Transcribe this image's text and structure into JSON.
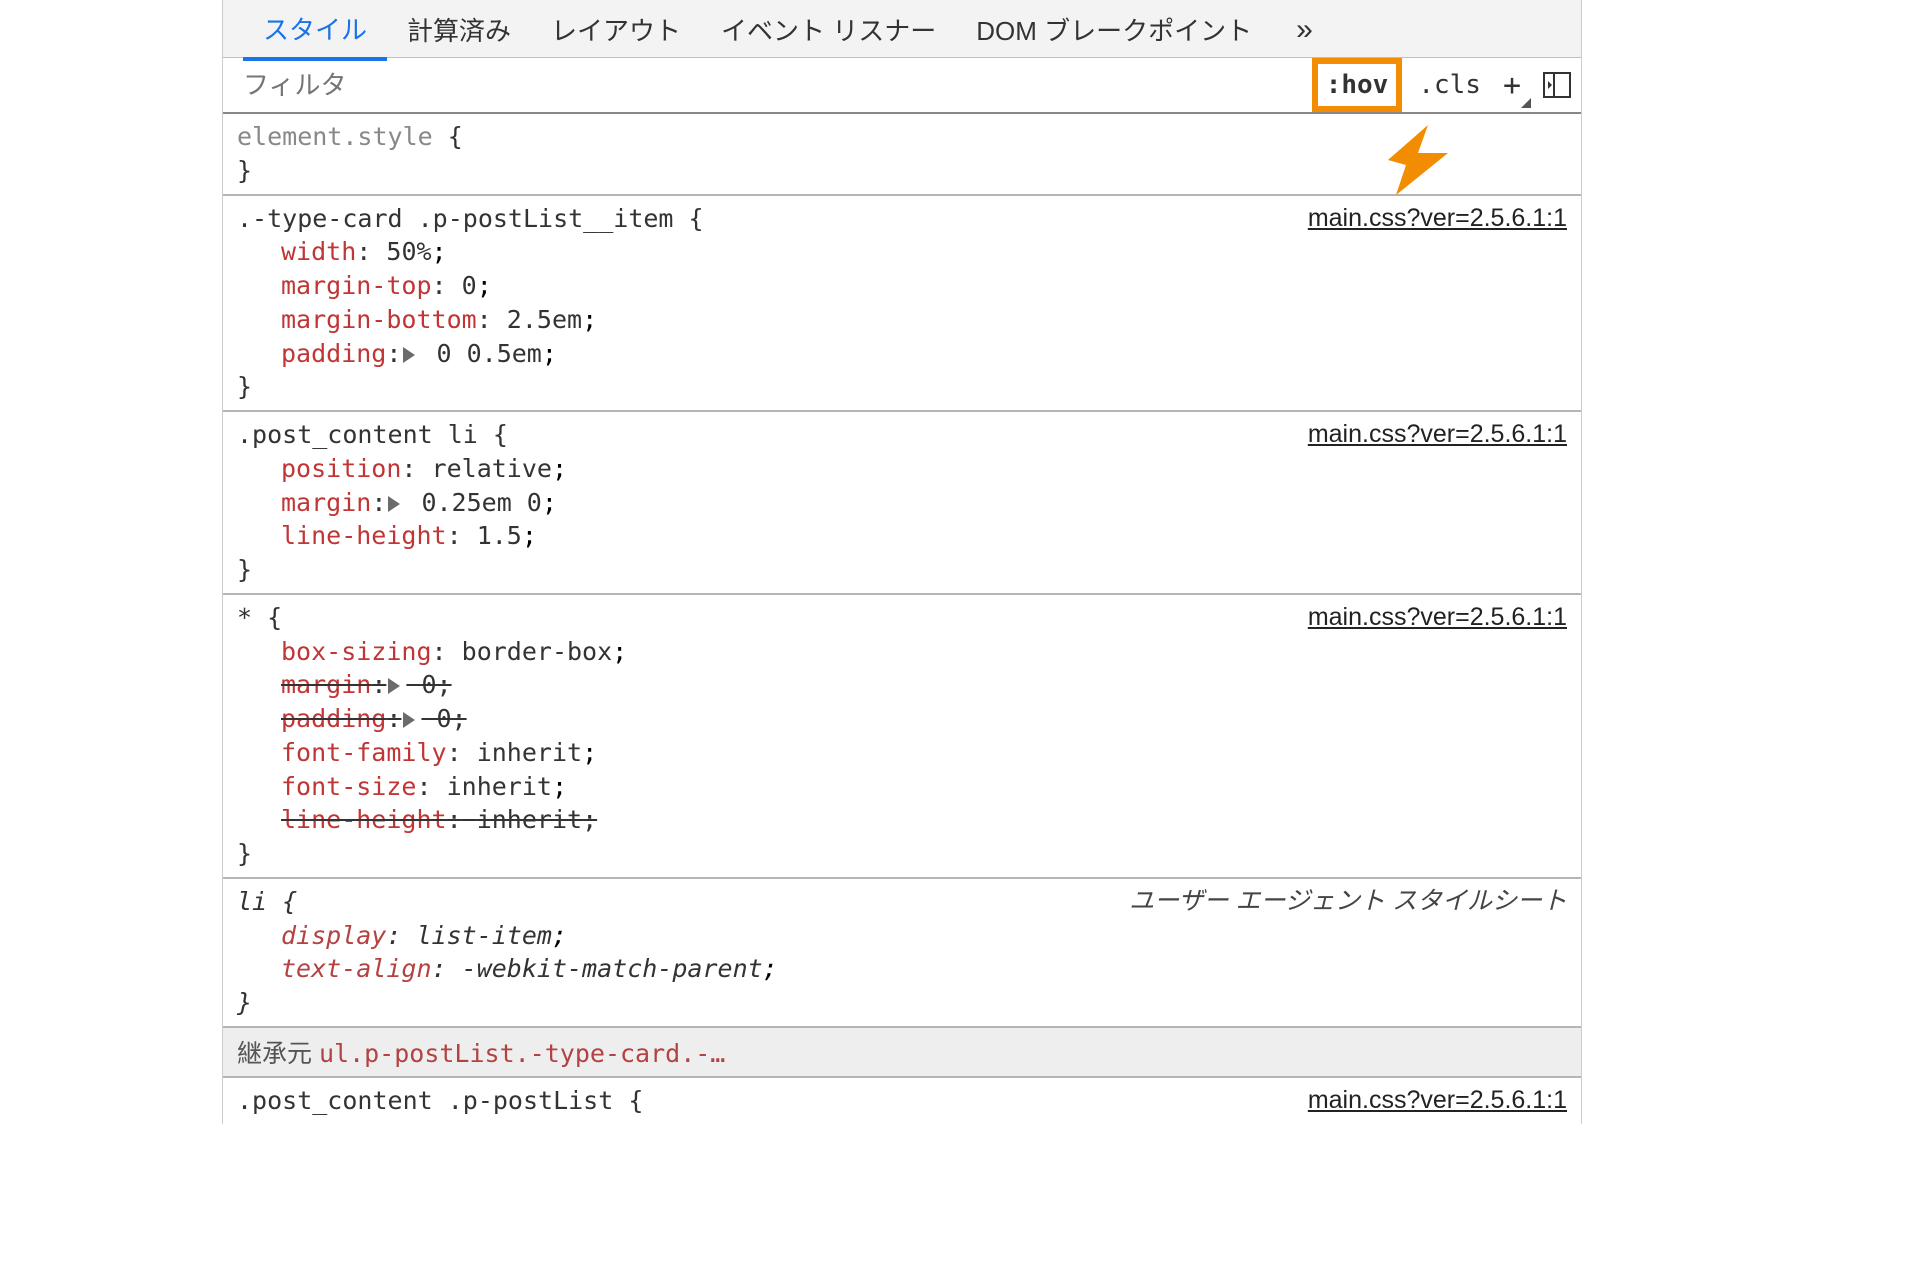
{
  "tabs": {
    "items": [
      "スタイル",
      "計算済み",
      "レイアウト",
      "イベント リスナー",
      "DOM ブレークポイント"
    ],
    "more": "»",
    "active_index": 0
  },
  "toolbar": {
    "filter_placeholder": "フィルタ",
    "hov": ":hov",
    "cls": ".cls",
    "plus": "+"
  },
  "element_style": {
    "selector": "element.style"
  },
  "rules": [
    {
      "selector": ".-type-card .p-postList__item",
      "source": "main.css?ver=2.5.6.1:1",
      "is_ua": false,
      "decls": [
        {
          "prop": "width",
          "value": "50%",
          "shorthand": false,
          "strike": false
        },
        {
          "prop": "margin-top",
          "value": "0",
          "shorthand": false,
          "strike": false
        },
        {
          "prop": "margin-bottom",
          "value": "2.5em",
          "shorthand": false,
          "strike": false
        },
        {
          "prop": "padding",
          "value": "0 0.5em",
          "shorthand": true,
          "strike": false
        }
      ]
    },
    {
      "selector": ".post_content li",
      "source": "main.css?ver=2.5.6.1:1",
      "is_ua": false,
      "decls": [
        {
          "prop": "position",
          "value": "relative",
          "shorthand": false,
          "strike": false
        },
        {
          "prop": "margin",
          "value": "0.25em 0",
          "shorthand": true,
          "strike": false
        },
        {
          "prop": "line-height",
          "value": "1.5",
          "shorthand": false,
          "strike": false
        }
      ]
    },
    {
      "selector": "*",
      "source": "main.css?ver=2.5.6.1:1",
      "is_ua": false,
      "decls": [
        {
          "prop": "box-sizing",
          "value": "border-box",
          "shorthand": false,
          "strike": false
        },
        {
          "prop": "margin",
          "value": "0",
          "shorthand": true,
          "strike": true
        },
        {
          "prop": "padding",
          "value": "0",
          "shorthand": true,
          "strike": true
        },
        {
          "prop": "font-family",
          "value": "inherit",
          "shorthand": false,
          "strike": false
        },
        {
          "prop": "font-size",
          "value": "inherit",
          "shorthand": false,
          "strike": false
        },
        {
          "prop": "line-height",
          "value": "inherit",
          "shorthand": false,
          "strike": true
        }
      ]
    },
    {
      "selector": "li",
      "source": "ユーザー エージェント スタイルシート",
      "is_ua": true,
      "decls": [
        {
          "prop": "display",
          "value": "list-item",
          "shorthand": false,
          "strike": false
        },
        {
          "prop": "text-align",
          "value": "-webkit-match-parent",
          "shorthand": false,
          "strike": false
        }
      ]
    }
  ],
  "inherit": {
    "label": "継承元",
    "selector": "ul.p-postList.-type-card.-…"
  },
  "tail_rule": {
    "selector": ".post_content .p-postList",
    "source": "main.css?ver=2.5.6.1:1"
  }
}
